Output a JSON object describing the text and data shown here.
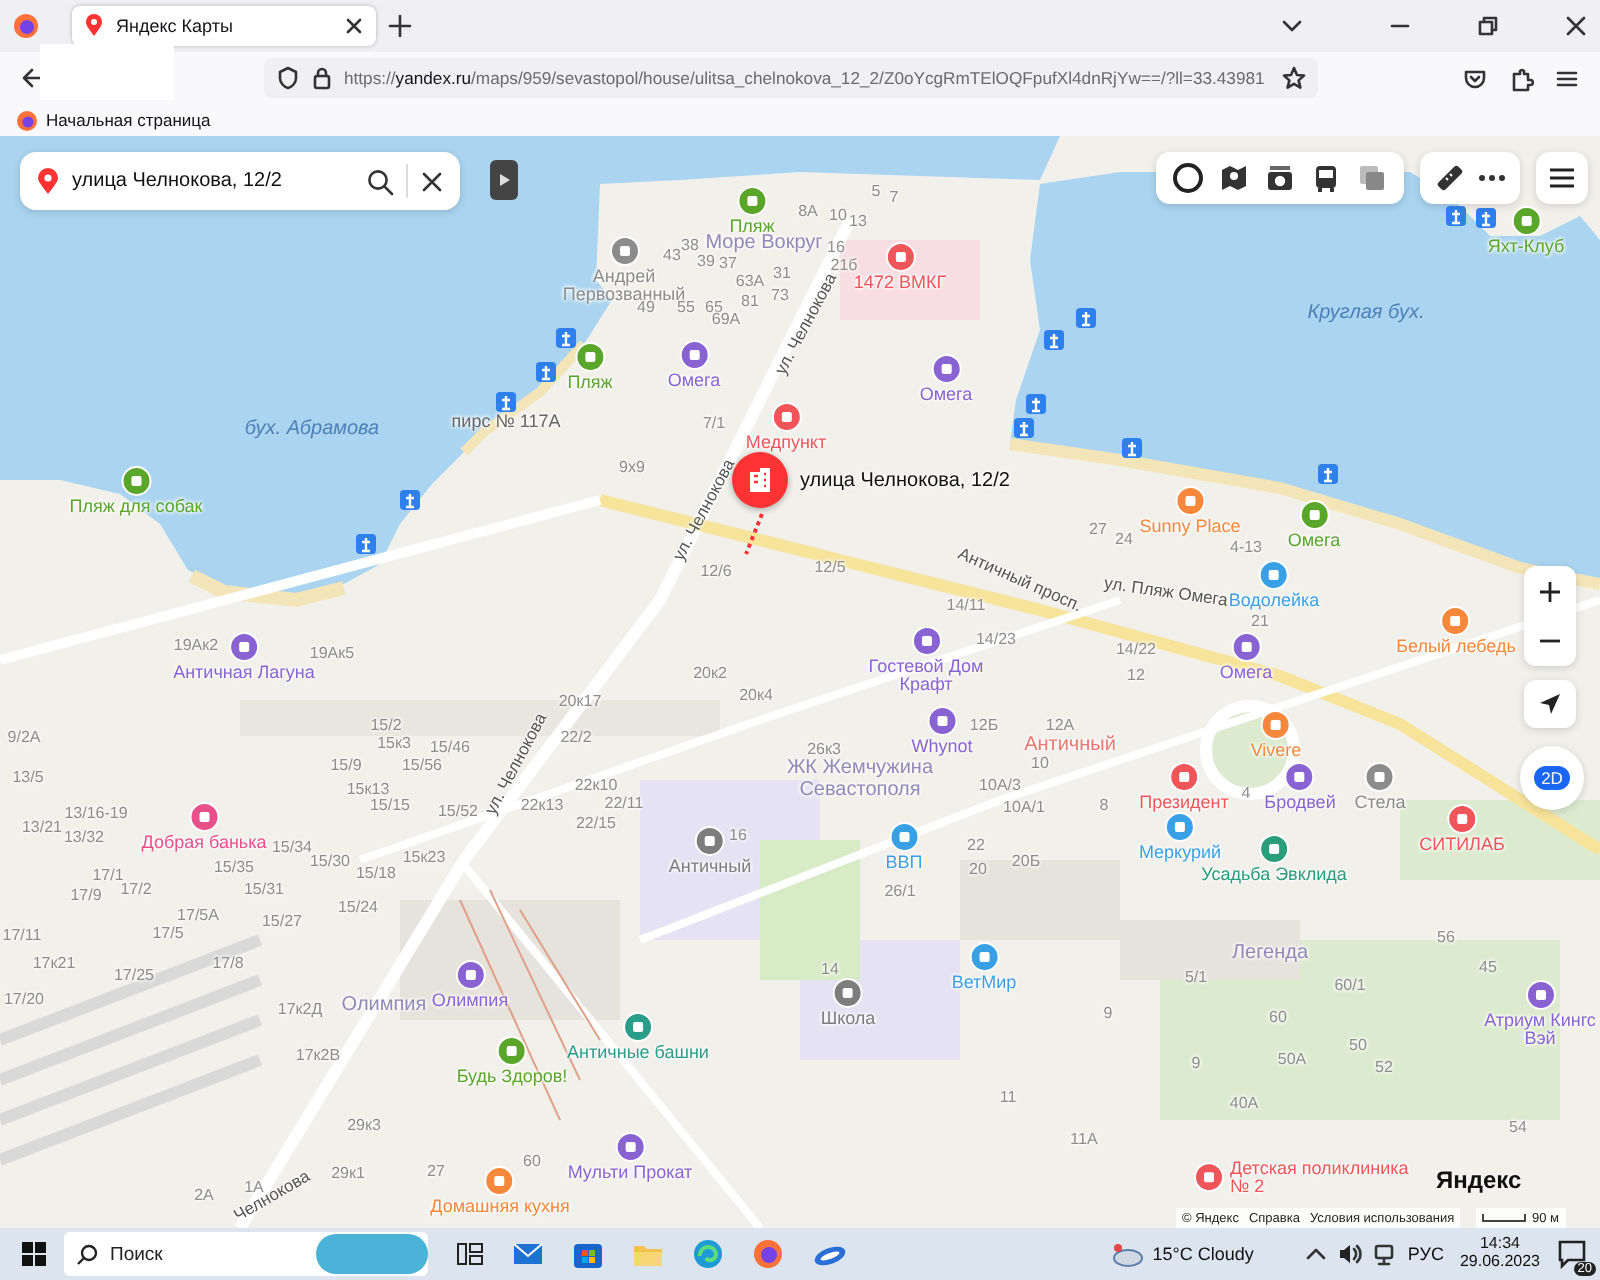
{
  "browser": {
    "tab_title": "Яндекс Карты",
    "url_scheme": "https://",
    "url_domain": "yandex.ru",
    "url_rest": "/maps/959/sevastopol/house/ulitsa_chelnokova_12_2/Z0oYcgRmTElOQFpufXl4dnRjYw==/?ll=33.43981",
    "bookmark": "Начальная страница"
  },
  "map": {
    "search": {
      "value": "улица Челнокова, 12/2"
    },
    "selected_place": "улица Челнокова, 12/2",
    "labels": [
      {
        "kind": "water",
        "text": "бух. Абрамова"
      },
      {
        "kind": "water",
        "text": "Круглая бух."
      },
      {
        "kind": "poi",
        "text": "Пляж",
        "color": "#5aa62b"
      },
      {
        "kind": "district",
        "text": "Море Вокруг",
        "color": "#9089b8"
      },
      {
        "kind": "poi",
        "text": "Андрей Первозванный",
        "color": "#8c8c8c"
      },
      {
        "kind": "poi",
        "text": "Пляж",
        "color": "#5aa62b"
      },
      {
        "kind": "poi",
        "text": "Омега",
        "color": "#8a63d2"
      },
      {
        "kind": "poi",
        "text": "1472 ВМКГ",
        "color": "#f0555a"
      },
      {
        "kind": "poi",
        "text": "Омега",
        "color": "#8a63d2"
      },
      {
        "kind": "place",
        "text": "пирс № 117А"
      },
      {
        "kind": "poi",
        "text": "Медпункт",
        "color": "#f0555a"
      },
      {
        "kind": "poi",
        "text": "Пляж для собак",
        "color": "#5aa62b"
      },
      {
        "kind": "poi",
        "text": "Яхт-Клуб",
        "color": "#5aa62b"
      },
      {
        "kind": "poi",
        "text": "Sunny Place",
        "color": "#f5883a"
      },
      {
        "kind": "poi",
        "text": "Омега",
        "color": "#5aa62b"
      },
      {
        "kind": "poi",
        "text": "Водолейка",
        "color": "#3aa0e6"
      },
      {
        "kind": "poi",
        "text": "Белый лебедь",
        "color": "#f5883a"
      },
      {
        "kind": "poi",
        "text": "Античная Лагуна",
        "color": "#8a63d2"
      },
      {
        "kind": "poi",
        "text": "Гостевой Дом Крафт",
        "color": "#8a63d2"
      },
      {
        "kind": "poi",
        "text": "Омега",
        "color": "#8a63d2"
      },
      {
        "kind": "poi",
        "text": "Whynot",
        "color": "#8a63d2"
      },
      {
        "kind": "poi",
        "text": "Vivere",
        "color": "#f5883a"
      },
      {
        "kind": "poi",
        "text": "Президент",
        "color": "#f0555a"
      },
      {
        "kind": "poi",
        "text": "Бродвей",
        "color": "#8a63d2"
      },
      {
        "kind": "poi",
        "text": "Стела",
        "color": "#8c8c8c"
      },
      {
        "kind": "poi",
        "text": "Античный",
        "color": "#7d7d7d"
      },
      {
        "kind": "poi",
        "text": "ВВП",
        "color": "#3aa0e6"
      },
      {
        "kind": "poi",
        "text": "Меркурий",
        "color": "#3aa0e6"
      },
      {
        "kind": "poi",
        "text": "Усадьба Эвклида",
        "color": "#2a9d7a"
      },
      {
        "kind": "poi",
        "text": "СИТИЛАБ",
        "color": "#f0555a"
      },
      {
        "kind": "poi",
        "text": "ВетМир",
        "color": "#3aa0e6"
      },
      {
        "kind": "poi",
        "text": "Школа",
        "color": "#7d7d7d"
      },
      {
        "kind": "poi",
        "text": "Атриум Кингс Вэй",
        "color": "#8a63d2"
      },
      {
        "kind": "poi",
        "text": "Добрая банька",
        "color": "#e8508a"
      },
      {
        "kind": "poi",
        "text": "Олимпия",
        "color": "#8a63d2"
      },
      {
        "kind": "poi",
        "text": "Античные башни",
        "color": "#2a9d8a"
      },
      {
        "kind": "poi",
        "text": "Будь Здоров!",
        "color": "#5aa62b"
      },
      {
        "kind": "poi",
        "text": "Мульти Прокат",
        "color": "#8a63d2"
      },
      {
        "kind": "poi",
        "text": "Домашняя кухня",
        "color": "#f5883a"
      },
      {
        "kind": "poi",
        "text": "Детская поликлиника № 2",
        "color": "#f0555a"
      },
      {
        "kind": "district",
        "text": "ЖК Жемчужина Севастополя",
        "color": "#9089b8"
      },
      {
        "kind": "district",
        "text": "Античный",
        "color": "#e8776f"
      },
      {
        "kind": "district",
        "text": "Олимпия",
        "color": "#9089b8"
      },
      {
        "kind": "district",
        "text": "Легенда",
        "color": "#9089b8"
      },
      {
        "kind": "street",
        "text": "ул. Челнокова"
      },
      {
        "kind": "street",
        "text": "ул. Челнокова"
      },
      {
        "kind": "street",
        "text": "ул. Челнокова"
      },
      {
        "kind": "street",
        "text": "Античный просп."
      },
      {
        "kind": "street",
        "text": "ул. Пляж Омега"
      },
      {
        "kind": "street",
        "text": "Челнокова"
      },
      {
        "kind": "house",
        "text": "38"
      },
      {
        "kind": "house",
        "text": "43"
      },
      {
        "kind": "house",
        "text": "39"
      },
      {
        "kind": "house",
        "text": "37"
      },
      {
        "kind": "house",
        "text": "63А"
      },
      {
        "kind": "house",
        "text": "31"
      },
      {
        "kind": "house",
        "text": "49"
      },
      {
        "kind": "house",
        "text": "55"
      },
      {
        "kind": "house",
        "text": "65"
      },
      {
        "kind": "house",
        "text": "81"
      },
      {
        "kind": "house",
        "text": "73"
      },
      {
        "kind": "house",
        "text": "69А"
      },
      {
        "kind": "house",
        "text": "7/1"
      },
      {
        "kind": "house",
        "text": "9х9"
      },
      {
        "kind": "house",
        "text": "12/6"
      },
      {
        "kind": "house",
        "text": "19Ак2"
      },
      {
        "kind": "house",
        "text": "19Ак5"
      },
      {
        "kind": "house",
        "text": "20к2"
      },
      {
        "kind": "house",
        "text": "20к4"
      },
      {
        "kind": "house",
        "text": "8А"
      },
      {
        "kind": "house",
        "text": "10"
      },
      {
        "kind": "house",
        "text": "13"
      },
      {
        "kind": "house",
        "text": "16"
      },
      {
        "kind": "house",
        "text": "21б"
      },
      {
        "kind": "house",
        "text": "5"
      },
      {
        "kind": "house",
        "text": "7"
      },
      {
        "kind": "house",
        "text": "27"
      },
      {
        "kind": "house",
        "text": "24"
      },
      {
        "kind": "house",
        "text": "4-13"
      },
      {
        "kind": "house",
        "text": "12/5"
      },
      {
        "kind": "house",
        "text": "14/11"
      },
      {
        "kind": "house",
        "text": "14/23"
      },
      {
        "kind": "house",
        "text": "14/22"
      },
      {
        "kind": "house",
        "text": "12"
      },
      {
        "kind": "house",
        "text": "21"
      },
      {
        "kind": "house",
        "text": "26к3"
      },
      {
        "kind": "house",
        "text": "12Б"
      },
      {
        "kind": "house",
        "text": "12А"
      },
      {
        "kind": "house",
        "text": "10"
      },
      {
        "kind": "house",
        "text": "10А/3"
      },
      {
        "kind": "house",
        "text": "10А/1"
      },
      {
        "kind": "house",
        "text": "8"
      },
      {
        "kind": "house",
        "text": "4"
      },
      {
        "kind": "house",
        "text": "22"
      },
      {
        "kind": "house",
        "text": "20"
      },
      {
        "kind": "house",
        "text": "20Б"
      },
      {
        "kind": "house",
        "text": "26/1"
      },
      {
        "kind": "house",
        "text": "14"
      },
      {
        "kind": "house",
        "text": "56"
      },
      {
        "kind": "house",
        "text": "5/1"
      },
      {
        "kind": "house",
        "text": "60/1"
      },
      {
        "kind": "house",
        "text": "45"
      },
      {
        "kind": "house",
        "text": "9"
      },
      {
        "kind": "house",
        "text": "60"
      },
      {
        "kind": "house",
        "text": "9"
      },
      {
        "kind": "house",
        "text": "50А"
      },
      {
        "kind": "house",
        "text": "50"
      },
      {
        "kind": "house",
        "text": "52"
      },
      {
        "kind": "house",
        "text": "11"
      },
      {
        "kind": "house",
        "text": "40А"
      },
      {
        "kind": "house",
        "text": "11А"
      },
      {
        "kind": "house",
        "text": "54"
      },
      {
        "kind": "house",
        "text": "9/2А"
      },
      {
        "kind": "house",
        "text": "15/2"
      },
      {
        "kind": "house",
        "text": "15к3"
      },
      {
        "kind": "house",
        "text": "15/46"
      },
      {
        "kind": "house",
        "text": "15/9"
      },
      {
        "kind": "house",
        "text": "15/56"
      },
      {
        "kind": "house",
        "text": "15к13"
      },
      {
        "kind": "house",
        "text": "15/15"
      },
      {
        "kind": "house",
        "text": "15/52"
      },
      {
        "kind": "house",
        "text": "13/5"
      },
      {
        "kind": "house",
        "text": "13/21"
      },
      {
        "kind": "house",
        "text": "13/16-19"
      },
      {
        "kind": "house",
        "text": "13/32"
      },
      {
        "kind": "house",
        "text": "15/35"
      },
      {
        "kind": "house",
        "text": "15/34"
      },
      {
        "kind": "house",
        "text": "15/30"
      },
      {
        "kind": "house",
        "text": "15/18"
      },
      {
        "kind": "house",
        "text": "15к23"
      },
      {
        "kind": "house",
        "text": "15/31"
      },
      {
        "kind": "house",
        "text": "15/24"
      },
      {
        "kind": "house",
        "text": "15/27"
      },
      {
        "kind": "house",
        "text": "17/1"
      },
      {
        "kind": "house",
        "text": "17/9"
      },
      {
        "kind": "house",
        "text": "17/2"
      },
      {
        "kind": "house",
        "text": "17/5А"
      },
      {
        "kind": "house",
        "text": "17/11"
      },
      {
        "kind": "house",
        "text": "17/5"
      },
      {
        "kind": "house",
        "text": "17к21"
      },
      {
        "kind": "house",
        "text": "17/25"
      },
      {
        "kind": "house",
        "text": "17/8"
      },
      {
        "kind": "house",
        "text": "17/20"
      },
      {
        "kind": "house",
        "text": "17к2Д"
      },
      {
        "kind": "house",
        "text": "17к2В"
      },
      {
        "kind": "house",
        "text": "22/2"
      },
      {
        "kind": "house",
        "text": "22к10"
      },
      {
        "kind": "house",
        "text": "22к13"
      },
      {
        "kind": "house",
        "text": "22/11"
      },
      {
        "kind": "house",
        "text": "22/15"
      },
      {
        "kind": "house",
        "text": "16"
      },
      {
        "kind": "house",
        "text": "20к17"
      },
      {
        "kind": "house",
        "text": "29к3"
      },
      {
        "kind": "house",
        "text": "29к1"
      },
      {
        "kind": "house",
        "text": "27"
      },
      {
        "kind": "house",
        "text": "60"
      },
      {
        "kind": "house",
        "text": "2А"
      },
      {
        "kind": "house",
        "text": "1А"
      }
    ],
    "brand": "Яндекс",
    "attribution": [
      "© Яндекс",
      "Справка",
      "Условия использования"
    ],
    "scale": "90 м",
    "view_mode": "2D"
  },
  "taskbar": {
    "search": {
      "placeholder": "Поиск"
    },
    "weather": "15°C Cloudy",
    "language": "РУС",
    "time": "14:34",
    "date": "29.06.2023",
    "notifications": "20"
  }
}
